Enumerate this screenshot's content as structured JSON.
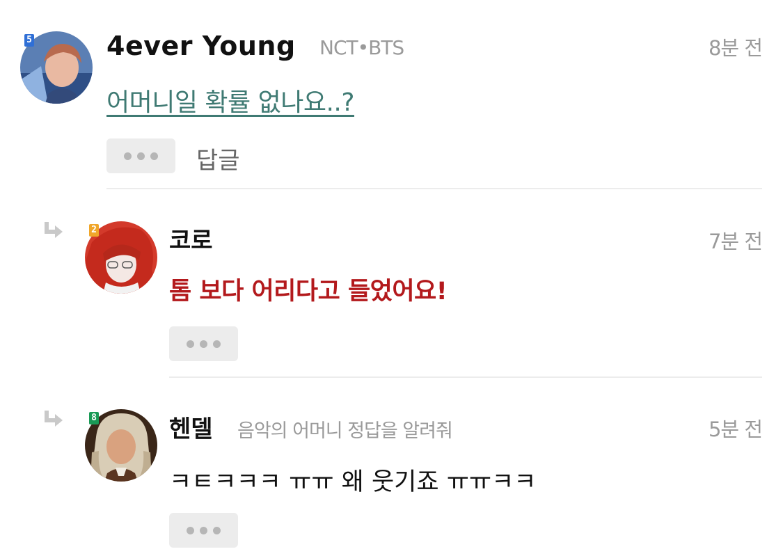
{
  "comments": [
    {
      "author": "4ever Young",
      "subtitle": "NCT•BTS",
      "time": "8분 전",
      "level": "5",
      "level_color": "#2f6fd6",
      "text": "어머니일 확률 없나요..?",
      "text_color": "#3f7a73",
      "reply_label": "답글"
    },
    {
      "author": "코로",
      "subtitle": "",
      "time": "7분 전",
      "level": "2",
      "level_color": "#f0a62a",
      "text": "톰 보다 어리다고 들었어요!",
      "text_color": "#b3191c"
    },
    {
      "author": "헨델",
      "subtitle": "음악의 어머니 정답을 알려줘",
      "time": "5분 전",
      "level": "8",
      "level_color": "#1a9a56",
      "text": "ㅋㅌㅋㅋㅋ ㅠㅠ 왜 웃기죠 ㅠㅠㅋㅋ",
      "text_color": "#111111"
    }
  ],
  "icons": {
    "more": "more-dots-icon",
    "reply": "reply-arrow-icon"
  }
}
